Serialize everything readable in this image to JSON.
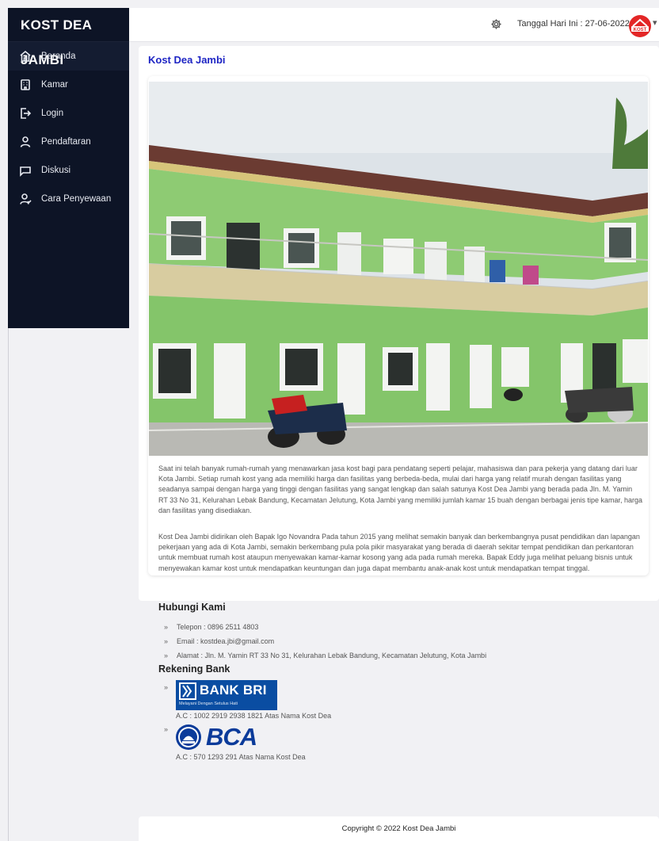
{
  "sidebar": {
    "brand": "KOST DEA JAMBI",
    "items": [
      {
        "label": "Beranda",
        "icon": "home-icon"
      },
      {
        "label": "Kamar",
        "icon": "building-icon"
      },
      {
        "label": "Login",
        "icon": "login-icon"
      },
      {
        "label": "Pendaftaran",
        "icon": "user-icon"
      },
      {
        "label": "Diskusi",
        "icon": "chat-icon"
      },
      {
        "label": "Cara Penyewaan",
        "icon": "user-check-icon"
      }
    ]
  },
  "topbar": {
    "date_text": "Tanggal Hari Ini : 27-06-2022",
    "avatar_text": "KOST",
    "caret": "▾"
  },
  "main": {
    "title": "Kost Dea Jambi",
    "paragraph1": "Saat ini telah banyak rumah-rumah yang menawarkan jasa kost bagi para pendatang seperti pelajar, mahasiswa dan para pekerja yang datang dari luar Kota Jambi. Setiap rumah kost yang ada memiliki harga dan fasilitas yang berbeda-beda, mulai dari harga yang relatif murah dengan fasilitas yang seadanya sampai dengan harga yang tinggi dengan fasilitas yang sangat lengkap dan salah satunya Kost Dea Jambi yang berada pada Jln. M. Yamin RT 33 No 31, Kelurahan Lebak Bandung, Kecamatan Jelutung, Kota Jambi yang memiliki jumlah kamar 15 buah dengan berbagai jenis tipe kamar, harga dan fasilitas yang disediakan.",
    "paragraph2": "Kost Dea Jambi didirikan oleh Bapak Igo Novandra Pada tahun 2015 yang melihat semakin banyak dan berkembangnya pusat pendidikan dan lapangan pekerjaan yang ada di Kota Jambi, semakin berkembang pula pola pikir masyarakat yang berada di daerah sekitar tempat pendidikan dan perkantoran untuk membuat rumah kost ataupun menyewakan kamar-kamar kosong yang ada pada rumah mereka. Bapak Eddy juga melihat peluang bisnis untuk menyewakan kamar kost untuk mendapatkan keuntungan dan juga dapat membantu anak-anak kost untuk mendapatkan tempat tinggal.",
    "contact_heading": "Hubungi Kami",
    "contacts": [
      "Telepon : 0896 2511 4803",
      "Email : kostdea.jbi@gmail.com",
      "Alamat : Jln. M. Yamin RT 33 No 31, Kelurahan Lebak Bandung, Kecamatan Jelutung, Kota Jambi"
    ],
    "bullet": "»",
    "bank_heading": "Rekening Bank",
    "banks": [
      {
        "logo_name": "BANK BRI",
        "logo_tagline": "Melayani Dengan Setulus Hati",
        "account": "A.C : 1002 2919 2938 1821 Atas Nama Kost Dea"
      },
      {
        "logo_name": "BCA",
        "account": "A.C : 570 1293 291 Atas Nama Kost Dea"
      }
    ]
  },
  "footer": {
    "copyright": "Copyright © 2022 Kost Dea Jambi"
  },
  "colors": {
    "sidebar_bg": "#0d1426",
    "title_blue": "#1e25c4",
    "bri_blue": "#0a4da2",
    "bca_blue": "#0b3b9a",
    "avatar_red": "#e32626"
  }
}
